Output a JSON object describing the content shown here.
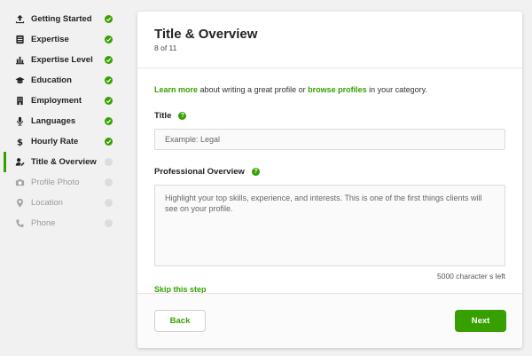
{
  "colors": {
    "accent": "#37a000",
    "pending": "#dcdcdc",
    "text": "#222222"
  },
  "sidebar": {
    "items": [
      {
        "label": "Getting Started",
        "icon": "upload-icon",
        "status": "complete"
      },
      {
        "label": "Expertise",
        "icon": "list-icon",
        "status": "complete"
      },
      {
        "label": "Expertise Level",
        "icon": "bar-chart-icon",
        "status": "complete"
      },
      {
        "label": "Education",
        "icon": "graduation-cap-icon",
        "status": "complete"
      },
      {
        "label": "Employment",
        "icon": "building-icon",
        "status": "complete"
      },
      {
        "label": "Languages",
        "icon": "microphone-icon",
        "status": "complete"
      },
      {
        "label": "Hourly Rate",
        "icon": "dollar-icon",
        "status": "complete"
      },
      {
        "label": "Title & Overview",
        "icon": "user-edit-icon",
        "status": "current"
      },
      {
        "label": "Profile Photo",
        "icon": "camera-icon",
        "status": "pending"
      },
      {
        "label": "Location",
        "icon": "map-pin-icon",
        "status": "pending"
      },
      {
        "label": "Phone",
        "icon": "phone-icon",
        "status": "pending"
      }
    ]
  },
  "header": {
    "title": "Title & Overview",
    "progress": "8 of 11"
  },
  "intro": {
    "link1": "Learn more",
    "text1": " about writing a great profile or ",
    "link2": "browse profiles",
    "text2": " in your category."
  },
  "title_field": {
    "label": "Title",
    "help": "?",
    "placeholder": "Example: Legal"
  },
  "overview_field": {
    "label": "Professional Overview",
    "help": "?",
    "placeholder": "Highlight your top skills, experience, and interests. This is one of the first things clients will see on your profile.",
    "char_count": "5000 character s left"
  },
  "skip_label": "Skip this step",
  "footer": {
    "back_label": "Back",
    "next_label": "Next"
  }
}
